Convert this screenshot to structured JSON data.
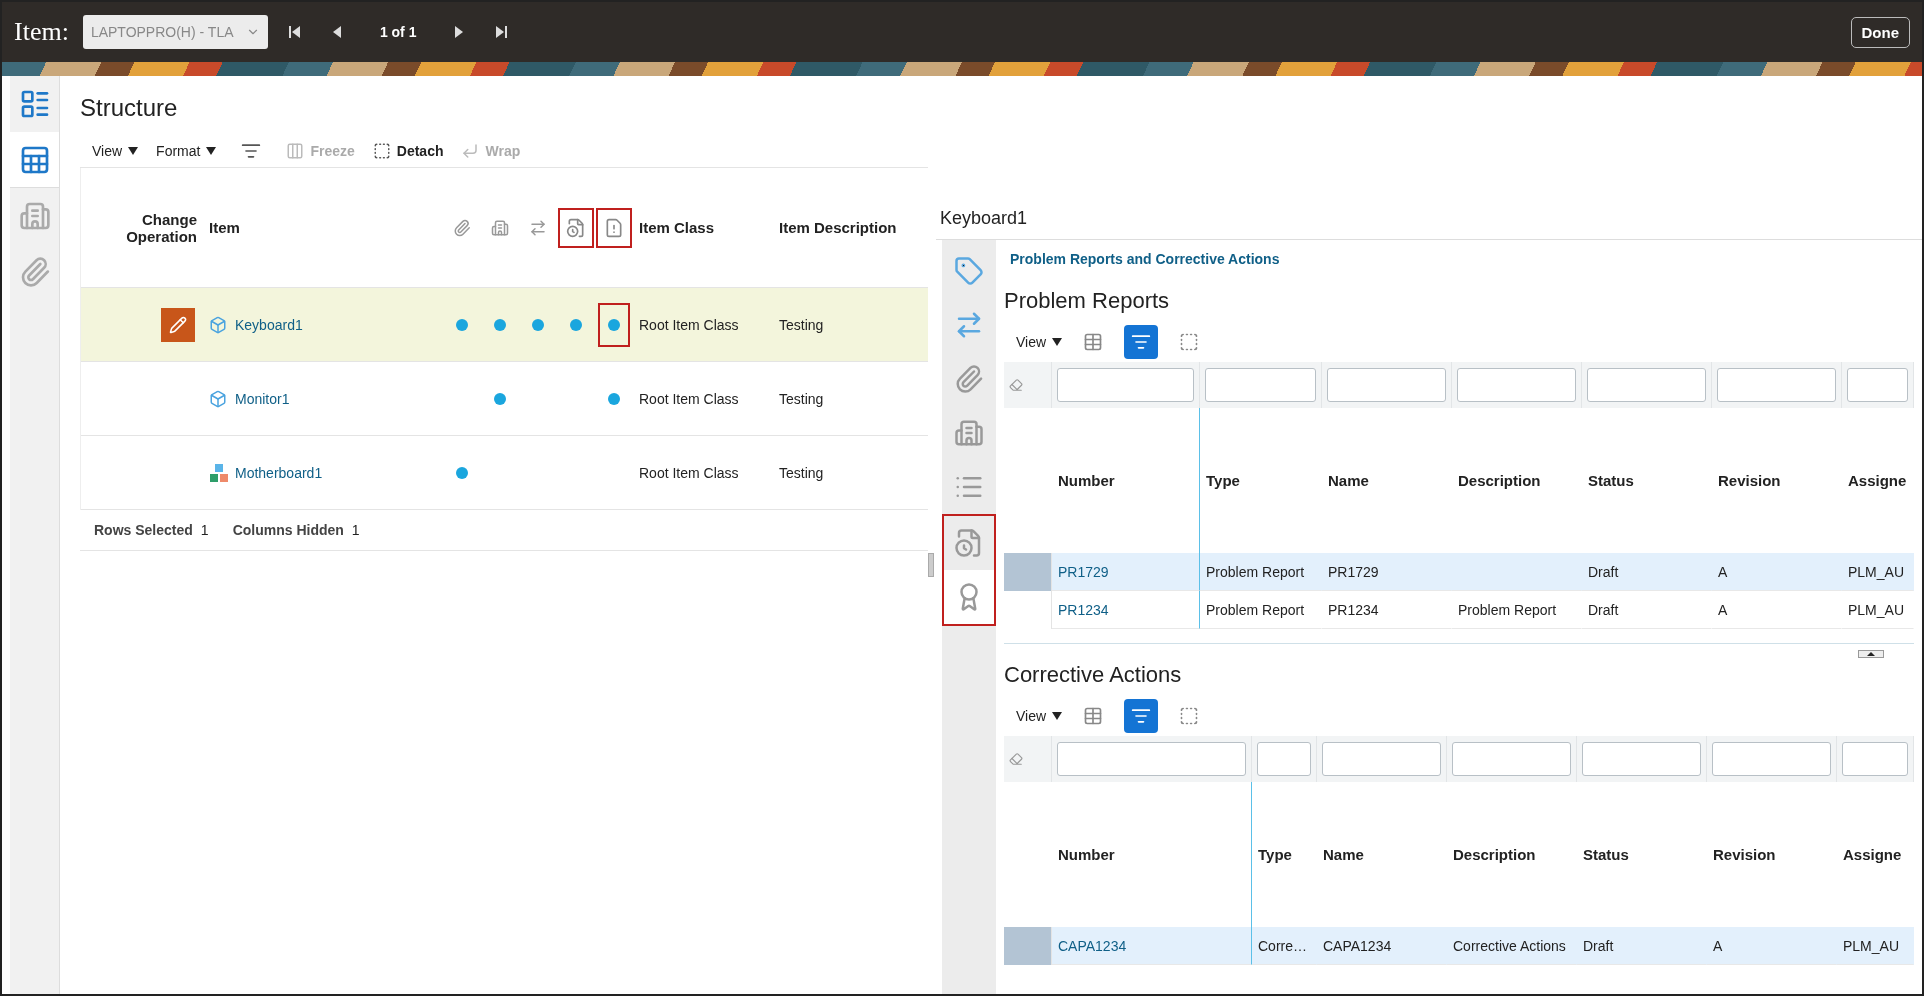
{
  "header": {
    "label": "Item:",
    "item_select": "LAPTOPPRO(H) - TLA",
    "pager": "1 of 1",
    "done": "Done"
  },
  "left_rail": [
    {
      "selected": false
    },
    {
      "selected": true
    },
    {
      "selected": false
    },
    {
      "selected": false
    }
  ],
  "structure": {
    "title": "Structure",
    "toolbar": [
      {
        "kind": "menu",
        "label": "View"
      },
      {
        "kind": "menu",
        "label": "Format"
      },
      {
        "kind": "icon"
      },
      {
        "kind": "button",
        "label": "Freeze",
        "disabled": true
      },
      {
        "kind": "button",
        "label": "Detach",
        "disabled": false
      },
      {
        "kind": "button",
        "label": "Wrap",
        "disabled": true
      }
    ],
    "columns": {
      "change": "Change Operation",
      "item": "Item",
      "item_class": "Item Class",
      "description": "Item Description"
    },
    "icon_columns": [
      {
        "highlighted": false
      },
      {
        "highlighted": false
      },
      {
        "highlighted": false
      },
      {
        "highlighted": true
      },
      {
        "highlighted": true
      }
    ],
    "rows": [
      {
        "selected": true,
        "editing": true,
        "kind": "part",
        "item": "Keyboard1",
        "flags": [
          {
            "on": true,
            "highlighted": false
          },
          {
            "on": true,
            "highlighted": false
          },
          {
            "on": true,
            "highlighted": false
          },
          {
            "on": true,
            "highlighted": false
          },
          {
            "on": true,
            "highlighted": true
          }
        ],
        "item_class": "Root Item Class",
        "description": "Testing"
      },
      {
        "selected": false,
        "editing": false,
        "kind": "part",
        "item": "Monitor1",
        "flags": [
          {
            "on": false,
            "highlighted": false
          },
          {
            "on": true,
            "highlighted": false
          },
          {
            "on": false,
            "highlighted": false
          },
          {
            "on": false,
            "highlighted": false
          },
          {
            "on": true,
            "highlighted": false
          }
        ],
        "item_class": "Root Item Class",
        "description": "Testing"
      },
      {
        "selected": false,
        "editing": false,
        "kind": "assembly",
        "item": "Motherboard1",
        "flags": [
          {
            "on": true,
            "highlighted": false
          },
          {
            "on": false,
            "highlighted": false
          },
          {
            "on": false,
            "highlighted": false
          },
          {
            "on": false,
            "highlighted": false
          },
          {
            "on": false,
            "highlighted": false
          }
        ],
        "item_class": "Root Item Class",
        "description": "Testing"
      }
    ],
    "footer": [
      {
        "label": "Rows Selected",
        "value": "1"
      },
      {
        "label": "Columns Hidden",
        "value": "1"
      }
    ]
  },
  "detail": {
    "title": "Keyboard1",
    "rail": [
      {
        "selected": false,
        "highlighted": false
      },
      {
        "selected": false,
        "highlighted": false
      },
      {
        "selected": false,
        "highlighted": false
      },
      {
        "selected": false,
        "highlighted": false
      },
      {
        "selected": false,
        "highlighted": false
      },
      {
        "selected": false,
        "highlighted": true
      },
      {
        "selected": true,
        "highlighted": true
      }
    ],
    "section_link": "Problem Reports and Corrective Actions",
    "tables": [
      {
        "title": "Problem Reports",
        "view": "View",
        "tools": [
          {
            "pressed": false
          },
          {
            "pressed": true
          },
          {
            "pressed": false
          }
        ],
        "columns": [
          "Number",
          "Type",
          "Name",
          "Description",
          "Status",
          "Revision",
          "Assigne"
        ],
        "rows": [
          {
            "selected": true,
            "cells": [
              "PR1729",
              "Problem Report",
              "PR1729",
              "",
              "Draft",
              "A",
              "PLM_AU"
            ]
          },
          {
            "selected": false,
            "cells": [
              "PR1234",
              "Problem Report",
              "PR1234",
              "Problem Report",
              "Draft",
              "A",
              "PLM_AU"
            ]
          }
        ]
      },
      {
        "title": "Corrective Actions",
        "view": "View",
        "tools": [
          {
            "pressed": false
          },
          {
            "pressed": true
          },
          {
            "pressed": false
          }
        ],
        "columns": [
          "Number",
          "Type",
          "Name",
          "Description",
          "Status",
          "Revision",
          "Assigne"
        ],
        "rows": [
          {
            "selected": true,
            "cells": [
              "CAPA1234",
              "Corre…",
              "CAPA1234",
              "Corrective Actions",
              "Draft",
              "A",
              "PLM_AU"
            ]
          }
        ]
      }
    ]
  }
}
